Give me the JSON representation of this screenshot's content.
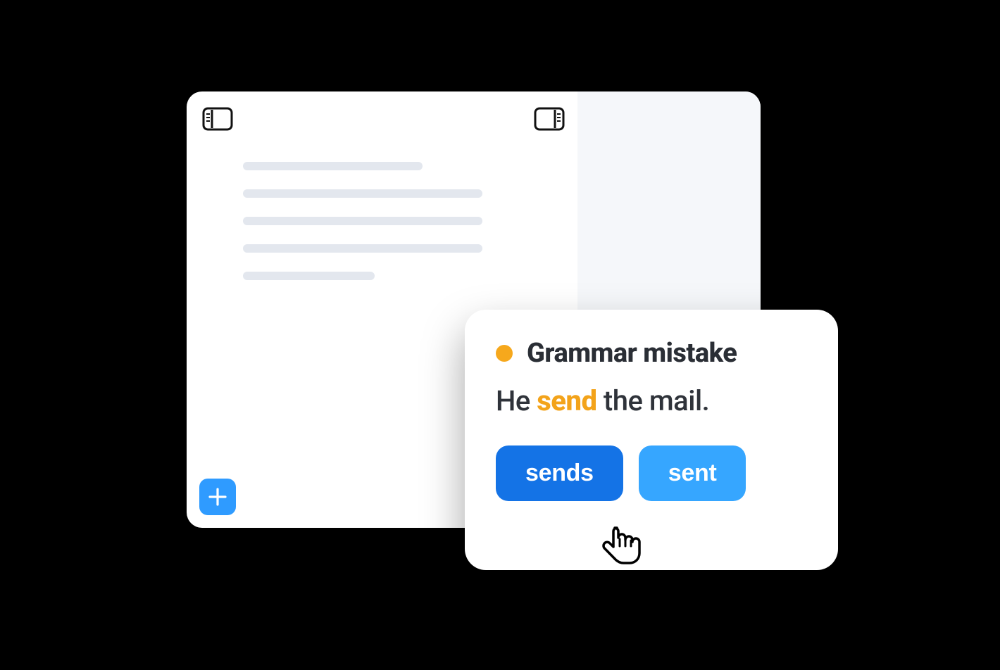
{
  "colors": {
    "accent_blue": "#2f9bff",
    "accent_blue_dark": "#1473e6",
    "accent_blue_light": "#36a6ff",
    "warning": "#f6a81c",
    "text_dark": "#2a2e35",
    "placeholder": "#e3e7ee",
    "sidebar_bg": "#f5f7fa"
  },
  "icons": {
    "left_panel": "panel-left-icon",
    "right_panel": "panel-right-icon",
    "add": "plus-icon",
    "cursor": "pointer-cursor-icon"
  },
  "card": {
    "status": "warning",
    "title": "Grammar mistake",
    "sentence": {
      "before": "He ",
      "highlight": "send",
      "after": " the mail."
    },
    "suggestions": [
      {
        "value": "sends",
        "variant": "primary"
      },
      {
        "value": "sent",
        "variant": "secondary"
      }
    ]
  }
}
